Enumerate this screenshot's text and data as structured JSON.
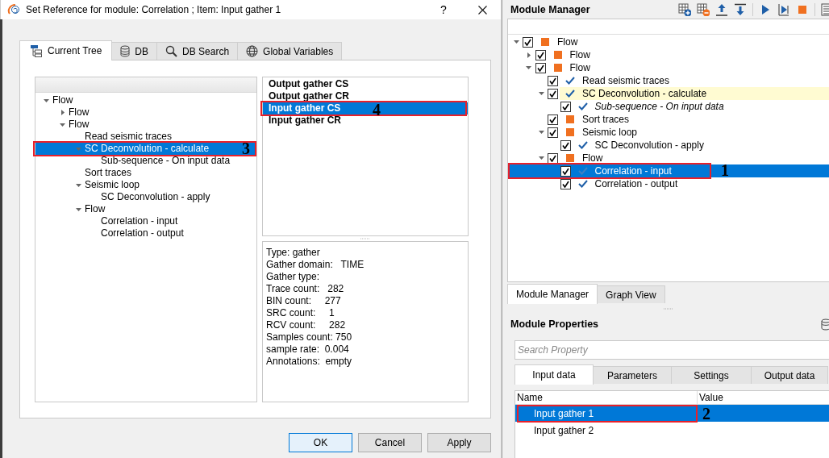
{
  "dialog": {
    "title": "Set Reference for module: Correlation ; Item: Input gather 1",
    "help": "?",
    "tabs": [
      {
        "label": "Current Tree",
        "selected": true
      },
      {
        "label": "DB",
        "selected": false
      },
      {
        "label": "DB Search",
        "selected": false
      },
      {
        "label": "Global Variables",
        "selected": false
      }
    ],
    "tree": [
      {
        "label": "Flow",
        "expanded": true,
        "selected": false,
        "children": [
          {
            "label": "Flow",
            "expanded": false,
            "selected": false
          },
          {
            "label": "Flow",
            "expanded": true,
            "selected": false,
            "children": [
              {
                "label": "Read seismic traces",
                "selected": false
              },
              {
                "label": "SC Deconvolution - calculate",
                "expanded": true,
                "selected": true,
                "callout": "3",
                "children": [
                  {
                    "label": "Sub-sequence - On input data",
                    "selected": false
                  }
                ]
              },
              {
                "label": "Sort traces",
                "selected": false
              },
              {
                "label": "Seismic loop",
                "expanded": true,
                "selected": false,
                "children": [
                  {
                    "label": "SC Deconvolution - apply",
                    "selected": false
                  }
                ]
              },
              {
                "label": "Flow",
                "expanded": true,
                "selected": false,
                "children": [
                  {
                    "label": "Correlation - input",
                    "selected": false
                  },
                  {
                    "label": "Correlation - output",
                    "selected": false
                  }
                ]
              }
            ]
          }
        ]
      }
    ],
    "outputs": [
      {
        "label": "Output gather CS",
        "selected": false
      },
      {
        "label": "Output gather CR",
        "selected": false
      },
      {
        "label": "Input gather CS",
        "selected": true,
        "callout": "4"
      },
      {
        "label": "Input gather CR",
        "selected": false
      }
    ],
    "info": [
      "Type: gather",
      "Gather domain:   TIME",
      "Gather type:",
      "Trace count:   282",
      "BIN count:     277",
      "SRC count:     1",
      "RCV count:     282",
      "Samples count: 750",
      "sample rate:  0.004",
      "Annotations:  empty"
    ],
    "buttons": [
      {
        "label": "OK",
        "default": true
      },
      {
        "label": "Cancel",
        "default": false
      },
      {
        "label": "Apply",
        "default": false
      }
    ]
  },
  "module_manager": {
    "title": "Module Manager",
    "tree": [
      {
        "label": "Flow",
        "kind": "block",
        "checked": true,
        "expanded": true,
        "selected": false,
        "children": [
          {
            "label": "Flow",
            "kind": "block",
            "checked": true,
            "expanded": false,
            "selected": false
          },
          {
            "label": "Flow",
            "kind": "block",
            "checked": true,
            "expanded": true,
            "selected": false,
            "children": [
              {
                "label": "Read seismic traces",
                "kind": "tick",
                "checked": true,
                "selected": false
              },
              {
                "label": "SC Deconvolution - calculate",
                "kind": "tick",
                "checked": true,
                "expanded": true,
                "selected": false,
                "highlighted": true,
                "children": [
                  {
                    "label": "Sub-sequence - On input data",
                    "kind": "tick",
                    "checked": true,
                    "selected": false,
                    "italic": true
                  }
                ]
              },
              {
                "label": "Sort traces",
                "kind": "block",
                "checked": true,
                "selected": false
              },
              {
                "label": "Seismic loop",
                "kind": "block",
                "checked": true,
                "expanded": true,
                "selected": false,
                "children": [
                  {
                    "label": "SC Deconvolution - apply",
                    "kind": "tick",
                    "checked": true,
                    "selected": false
                  }
                ]
              },
              {
                "label": "Flow",
                "kind": "block",
                "checked": true,
                "expanded": true,
                "selected": false,
                "children": [
                  {
                    "label": "Correlation - input",
                    "kind": "tick",
                    "checked": true,
                    "selected": true,
                    "callout": "1"
                  },
                  {
                    "label": "Correlation - output",
                    "kind": "tick",
                    "checked": true,
                    "selected": false
                  }
                ]
              }
            ]
          }
        ]
      }
    ],
    "tabs": [
      {
        "label": "Module Manager",
        "selected": true
      },
      {
        "label": "Graph View",
        "selected": false
      }
    ]
  },
  "module_properties": {
    "title": "Module Properties",
    "search": {
      "placeholder": "Search Property"
    },
    "tabs": [
      {
        "label": "Input data",
        "selected": true
      },
      {
        "label": "Parameters",
        "selected": false
      },
      {
        "label": "Settings",
        "selected": false
      },
      {
        "label": "Output data",
        "selected": false
      }
    ],
    "columns": [
      "Name",
      "Value"
    ],
    "rows": [
      {
        "name": "Input gather 1",
        "selected": true,
        "callout": "2"
      },
      {
        "name": "Input gather 2",
        "selected": false
      }
    ]
  }
}
